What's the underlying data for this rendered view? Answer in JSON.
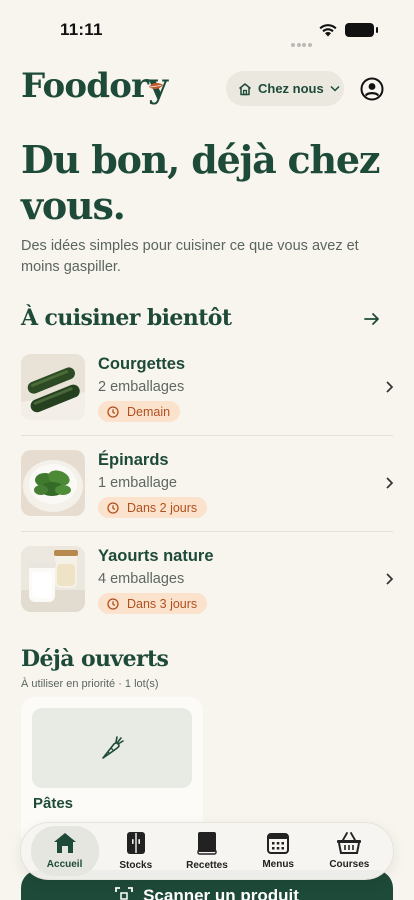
{
  "status_bar": {
    "time": "11:11"
  },
  "header": {
    "logo": "Foodory",
    "home_selector": "Chez nous",
    "icons": {
      "home": "home-icon",
      "chevron": "chevron-down-icon",
      "profile": "profile-icon"
    }
  },
  "hero": {
    "title": "Du bon, déjà chez vous.",
    "subtitle": "Des idées simples pour cuisiner ce que vous avez et moins gaspiller."
  },
  "cook_soon": {
    "title": "À cuisiner bientôt",
    "items": [
      {
        "name": "Courgettes",
        "packages": "2 emballages",
        "badge": "Demain",
        "image": "courgettes-photo"
      },
      {
        "name": "Épinards",
        "packages": "1 emballage",
        "badge": "Dans 2 jours",
        "image": "spinach-photo"
      },
      {
        "name": "Yaourts nature",
        "packages": "4 emballages",
        "badge": "Dans 3 jours",
        "image": "yogurt-photo"
      }
    ]
  },
  "opened": {
    "title": "Déjà ouverts",
    "subtitle": "À utiliser en priorité · 1 lot(s)",
    "cards": [
      {
        "name": "Pâtes",
        "icon": "carrot-icon"
      }
    ]
  },
  "tabbar": {
    "tabs": [
      {
        "label": "Accueil",
        "icon": "home-icon",
        "active": true
      },
      {
        "label": "Stocks",
        "icon": "fridge-icon",
        "active": false
      },
      {
        "label": "Recettes",
        "icon": "book-icon",
        "active": false
      },
      {
        "label": "Menus",
        "icon": "calendar-icon",
        "active": false
      },
      {
        "label": "Courses",
        "icon": "basket-icon",
        "active": false
      }
    ]
  },
  "scan_button": {
    "label": "Scanner un produit",
    "icon": "scan-icon"
  },
  "colors": {
    "primary": "#1e4a39",
    "background": "#f8f5ee",
    "badge_bg": "#fbe2cc",
    "badge_text": "#b1501f",
    "accent_leaf": "#c0592d"
  }
}
